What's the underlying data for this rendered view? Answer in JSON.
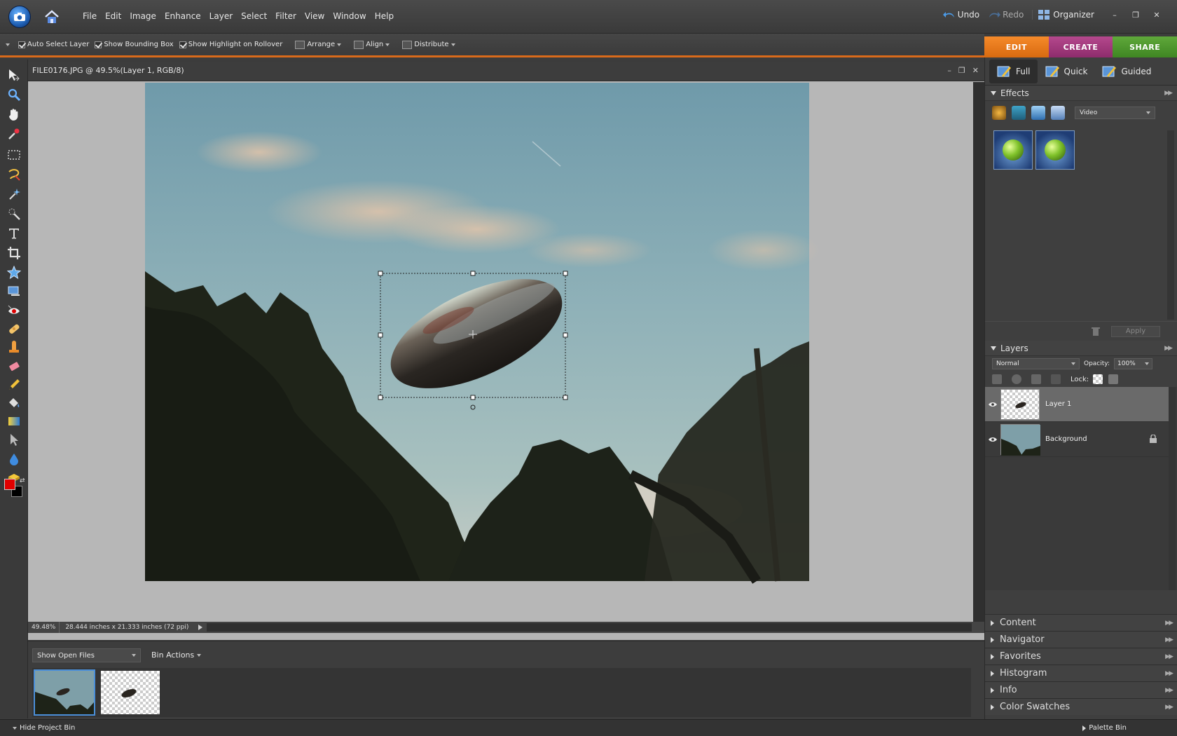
{
  "menubar": {
    "items": [
      "File",
      "Edit",
      "Image",
      "Enhance",
      "Layer",
      "Select",
      "Filter",
      "View",
      "Window",
      "Help"
    ],
    "undo_label": "Undo",
    "redo_label": "Redo",
    "organizer_label": "Organizer"
  },
  "options": {
    "auto_select": "Auto Select Layer",
    "bounding_box": "Show Bounding Box",
    "highlight": "Show Highlight on Rollover",
    "arrange": "Arrange",
    "align": "Align",
    "distribute": "Distribute"
  },
  "modes": {
    "edit": "EDIT",
    "create": "CREATE",
    "share": "SHARE"
  },
  "document": {
    "title": "FILE0176.JPG @ 49.5%(Layer 1, RGB/8)",
    "zoom": "49.48%",
    "dimensions": "28.444 inches x 21.333 inches (72 ppi)"
  },
  "projectbin": {
    "show_select": "Show Open Files",
    "bin_actions": "Bin Actions",
    "hide_label": "Hide Project Bin",
    "palette_bin_label": "Palette Bin"
  },
  "rightpanel": {
    "subtabs": [
      "Full",
      "Quick",
      "Guided"
    ],
    "effects": {
      "title": "Effects",
      "category": "Video",
      "apply_label": "Apply"
    },
    "layers": {
      "title": "Layers",
      "blend_mode": "Normal",
      "opacity_label": "Opacity:",
      "opacity_value": "100%",
      "lock_label": "Lock:",
      "items": [
        {
          "name": "Layer 1",
          "selected": true
        },
        {
          "name": "Background",
          "selected": false
        }
      ]
    },
    "collapsed": [
      "Content",
      "Navigator",
      "Favorites",
      "Histogram",
      "Info",
      "Color Swatches"
    ]
  },
  "colors": {
    "accent_edit": "#e8781e",
    "accent_create": "#a23a7e",
    "accent_share": "#4f9a2e",
    "foreground_color": "#e00000",
    "background_color": "#000000"
  }
}
